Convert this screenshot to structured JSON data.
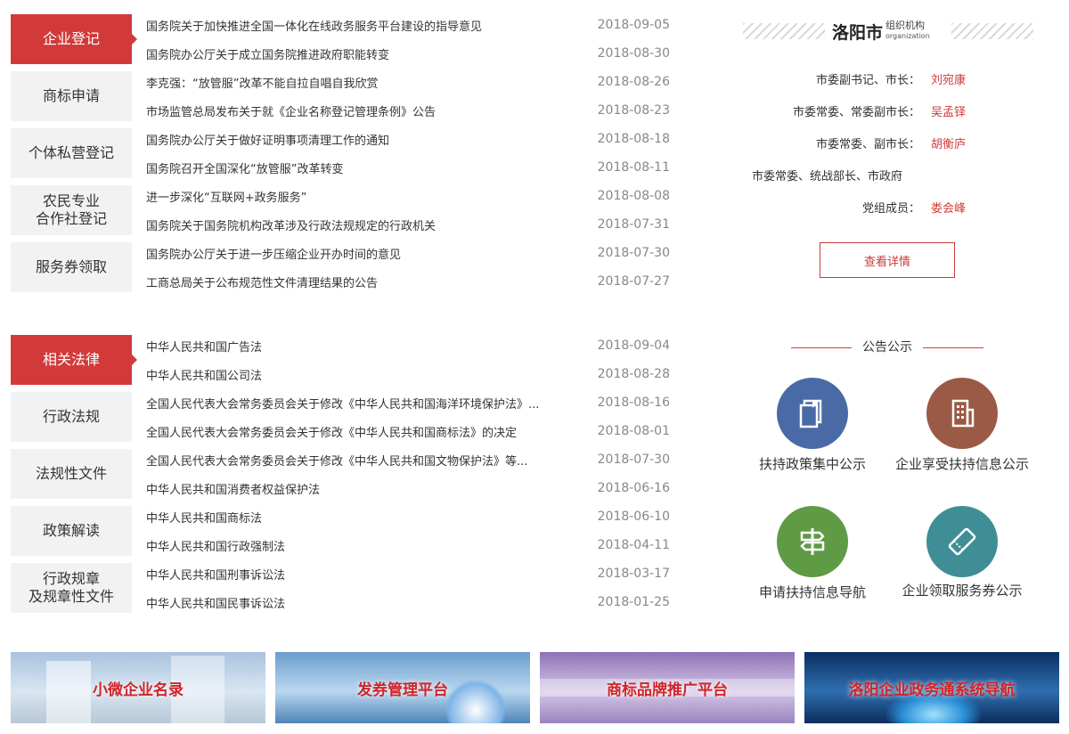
{
  "section1": {
    "tabs": [
      "企业登记",
      "商标申请",
      "个体私营登记",
      "农民专业\n合作社登记",
      "服务券领取"
    ],
    "items": [
      {
        "title": "国务院关于加快推进全国一体化在线政务服务平台建设的指导意见",
        "date": "2018-09-05"
      },
      {
        "title": "国务院办公厅关于成立国务院推进政府职能转变",
        "date": "2018-08-30"
      },
      {
        "title": "李克强：“放管服”改革不能自拉自唱自我欣赏",
        "date": "2018-08-26"
      },
      {
        "title": "市场监管总局发布关于就《企业名称登记管理条例》公告",
        "date": "2018-08-23"
      },
      {
        "title": "国务院办公厅关于做好证明事项清理工作的通知",
        "date": "2018-08-18"
      },
      {
        "title": "国务院召开全国深化“放管服”改革转变",
        "date": "2018-08-11"
      },
      {
        "title": "进一步深化“互联网+政务服务”",
        "date": "2018-08-08"
      },
      {
        "title": "国务院关于国务院机构改革涉及行政法规规定的行政机关",
        "date": "2018-07-31"
      },
      {
        "title": "国务院办公厅关于进一步压缩企业开办时间的意见",
        "date": "2018-07-30"
      },
      {
        "title": "工商总局关于公布规范性文件清理结果的公告",
        "date": "2018-07-27"
      }
    ]
  },
  "section2": {
    "tabs": [
      "相关法律",
      "行政法规",
      "法规性文件",
      "政策解读",
      "行政规章\n及规章性文件"
    ],
    "items": [
      {
        "title": "中华人民共和国广告法",
        "date": "2018-09-04"
      },
      {
        "title": "中华人民共和国公司法",
        "date": "2018-08-28"
      },
      {
        "title": "全国人民代表大会常务委员会关于修改《中华人民共和国海洋环境保护法》...",
        "date": "2018-08-16"
      },
      {
        "title": "全国人民代表大会常务委员会关于修改《中华人民共和国商标法》的决定",
        "date": "2018-08-01"
      },
      {
        "title": "全国人民代表大会常务委员会关于修改《中华人民共和国文物保护法》等...",
        "date": "2018-07-30"
      },
      {
        "title": "中华人民共和国消费者权益保护法",
        "date": "2018-06-16"
      },
      {
        "title": "中华人民共和国商标法",
        "date": "2018-06-10"
      },
      {
        "title": "中华人民共和国行政强制法",
        "date": "2018-04-11"
      },
      {
        "title": "中华人民共和国刑事诉讼法",
        "date": "2018-03-17"
      },
      {
        "title": "中华人民共和国民事诉讼法",
        "date": "2018-01-25"
      }
    ]
  },
  "org": {
    "city": "洛阳市",
    "label_cn": "组织机构",
    "label_en": "organization",
    "leaders": [
      {
        "role": "市委副书记、市长：",
        "name": "刘宛康"
      },
      {
        "role": "市委常委、常委副市长：",
        "name": "吴孟铎"
      },
      {
        "role": "市委常委、副市长：",
        "name": "胡衡庐"
      },
      {
        "role": "市委常委、统战部长、市政府",
        "name": ""
      },
      {
        "role": "党组成员：",
        "name": "娄会峰"
      }
    ],
    "detail_button": "查看详情"
  },
  "notice": {
    "title": "公告公示",
    "items": [
      {
        "label": "扶持政策集中公示",
        "icon": "document-copy-icon",
        "color": "#4a6aa5"
      },
      {
        "label": "企业享受扶持信息公示",
        "icon": "building-icon",
        "color": "#9a5a45"
      },
      {
        "label": "申请扶持信息导航",
        "icon": "signpost-icon",
        "color": "#5f9a45"
      },
      {
        "label": "企业领取服务券公示",
        "icon": "ticket-icon",
        "color": "#3f8e96"
      }
    ]
  },
  "banners": [
    "小微企业名录",
    "发券管理平台",
    "商标品牌推广平台",
    "洛阳企业政务通系统导航"
  ]
}
